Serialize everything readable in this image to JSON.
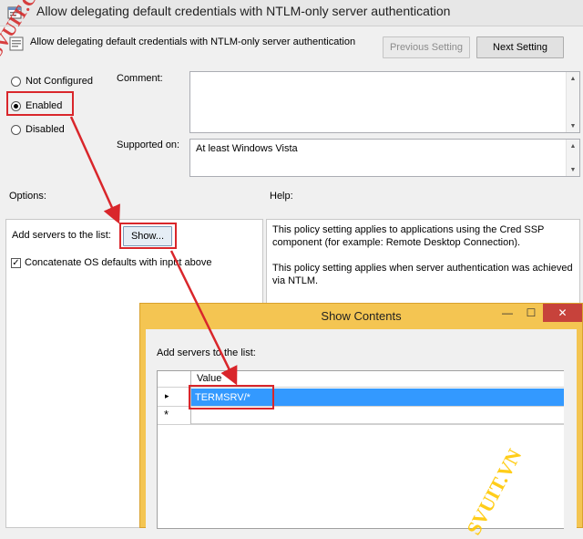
{
  "window": {
    "title": "Allow delegating default credentials with NTLM-only server authentication",
    "policy_name": "Allow delegating default credentials with NTLM-only server authentication",
    "app_icon": "policy-window-icon",
    "policy_icon": "policy-setting-icon"
  },
  "nav": {
    "previous_label": "Previous Setting",
    "next_label": "Next Setting",
    "previous_enabled": false
  },
  "state": {
    "options": [
      {
        "label": "Not Configured",
        "checked": false
      },
      {
        "label": "Enabled",
        "checked": true
      },
      {
        "label": "Disabled",
        "checked": false
      }
    ]
  },
  "comment": {
    "label": "Comment:",
    "value": ""
  },
  "supported": {
    "label": "Supported on:",
    "value": "At least Windows Vista"
  },
  "options_section": {
    "label": "Options:",
    "add_servers_label": "Add servers to the list:",
    "show_button": "Show...",
    "concatenate_label": "Concatenate OS defaults with input above",
    "concatenate_checked": true
  },
  "help_section": {
    "label": "Help:",
    "paragraphs": [
      "This policy setting applies to applications using the Cred SSP component (for example: Remote Desktop Connection).",
      "This policy setting applies when server authentication was achieved via NTLM."
    ]
  },
  "dialog": {
    "title": "Show Contents",
    "label": "Add servers to the list:",
    "column_header": "Value",
    "rows": [
      "TERMSRV/*"
    ],
    "new_row_marker": "*",
    "current_row_marker": "▸",
    "minimize_glyph": "—",
    "maximize_glyph": "☐",
    "close_glyph": "✕"
  },
  "watermarks": [
    "SVUIT.COM",
    "SVUIT.VN"
  ],
  "colors": {
    "highlight": "#d9262b",
    "dialog_frame": "#f4c552",
    "selection": "#3399ff",
    "close_button": "#c7423b"
  }
}
